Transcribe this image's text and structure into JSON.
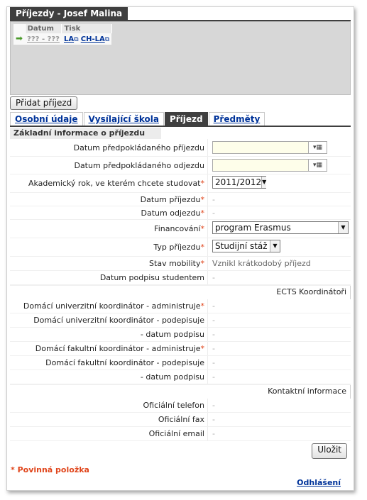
{
  "window": {
    "title": "Příjezdy - Josef Malina"
  },
  "arrivals_table": {
    "headers": [
      "Datum",
      "Tisk"
    ],
    "rows": [
      {
        "date": "??? - ???",
        "print_la": "LA",
        "print_ch_la": "CH-LA"
      }
    ]
  },
  "buttons": {
    "add_arrival": "Přidat příjezd",
    "save": "Uložit"
  },
  "tabs": [
    {
      "label": "Osobní údaje",
      "active": false
    },
    {
      "label": "Vysílající škola",
      "active": false
    },
    {
      "label": "Příjezd",
      "active": true
    },
    {
      "label": "Předměty",
      "active": false
    }
  ],
  "section_title": "Základní informace o příjezdu",
  "fields": {
    "expected_arrival": {
      "label": "Datum předpokládaného příjezdu",
      "value": ""
    },
    "expected_departure": {
      "label": "Datum předpokládaného odjezdu",
      "value": ""
    },
    "academic_year": {
      "label": "Akademický rok, ve kterém chcete studovat",
      "value": "2011/2012"
    },
    "arrival_date": {
      "label": "Datum příjezdu",
      "value": "-"
    },
    "departure_date": {
      "label": "Datum odjezdu",
      "value": "-"
    },
    "funding": {
      "label": "Financování",
      "value": "program Erasmus"
    },
    "arrival_type": {
      "label": "Typ příjezdu",
      "value": "Studijní stáž"
    },
    "mobility_status": {
      "label": "Stav mobility",
      "value": "Vznikl krátkodobý příjezd"
    },
    "student_signature_date": {
      "label": "Datum podpisu studentem",
      "value": "-"
    }
  },
  "ects_section": {
    "title": "ECTS Koordinátoři",
    "rows": [
      {
        "label": "Domácí univerzitní koordinátor - administruje",
        "required": true,
        "value": "-"
      },
      {
        "label": "Domácí univerzitní koordinátor - podepisuje",
        "required": false,
        "value": "-"
      },
      {
        "label": "- datum podpisu",
        "required": false,
        "value": "-"
      },
      {
        "label": "Domácí fakultní koordinátor - administruje",
        "required": true,
        "value": "-"
      },
      {
        "label": "Domácí fakultní koordinátor - podepisuje",
        "required": false,
        "value": "-"
      },
      {
        "label": "- datum podpisu",
        "required": false,
        "value": "-"
      }
    ]
  },
  "contact_section": {
    "title": "Kontaktní informace",
    "rows": [
      {
        "label": "Oficiální telefon",
        "value": "-"
      },
      {
        "label": "Oficiální fax",
        "value": "-"
      },
      {
        "label": "Oficiální email",
        "value": "-"
      }
    ]
  },
  "required_marker": "*",
  "footer": {
    "mandatory_note": "* Povinná položka",
    "logout": "Odhlášení"
  },
  "colors": {
    "required": "#e0451b",
    "link": "#003399",
    "dark_header": "#3f3f3f"
  }
}
